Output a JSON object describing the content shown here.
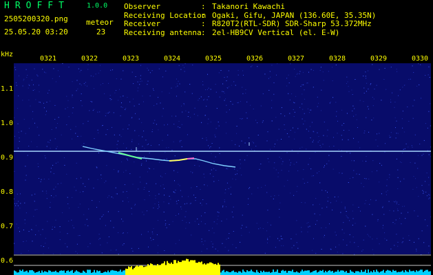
{
  "header": {
    "app_title": "HROFFT",
    "version": "1.0.0",
    "filename": "2505200320.png",
    "meteor_label": "meteor",
    "datetime": "25.05.20 03:20",
    "meteor_count": "23",
    "info": [
      {
        "key": "Observer",
        "sep": ":",
        "value": "Takanori Kawachi"
      },
      {
        "key": "Receiving Location",
        "sep": ":",
        "value": "Ogaki, Gifu, JAPAN (136.60E, 35.35N)"
      },
      {
        "key": "Receiver",
        "sep": ":",
        "value": "R820T2(RTL-SDR) SDR-Sharp 53.372MHz"
      },
      {
        "key": "Receiving antenna",
        "sep": ":",
        "value": "2el-HB9CV Vertical (el. E-W)"
      }
    ]
  },
  "axes": {
    "y_unit": "kHz",
    "y_ticks": [
      "1.1",
      "1.0",
      "0.9",
      "0.8",
      "0.7",
      "0.6"
    ],
    "x_ticks": [
      "0321",
      "0322",
      "0323",
      "0324",
      "0325",
      "0326",
      "0327",
      "0328",
      "0329",
      "0330"
    ]
  },
  "colors": {
    "background": "#000000",
    "plot_bg": "#080c6a",
    "carrier": "#a8d8ff",
    "text_green": "#00ff66",
    "text_yellow": "#ffff00",
    "level_cyan": "#00d0ff",
    "level_yellow": "#ffff00"
  }
}
